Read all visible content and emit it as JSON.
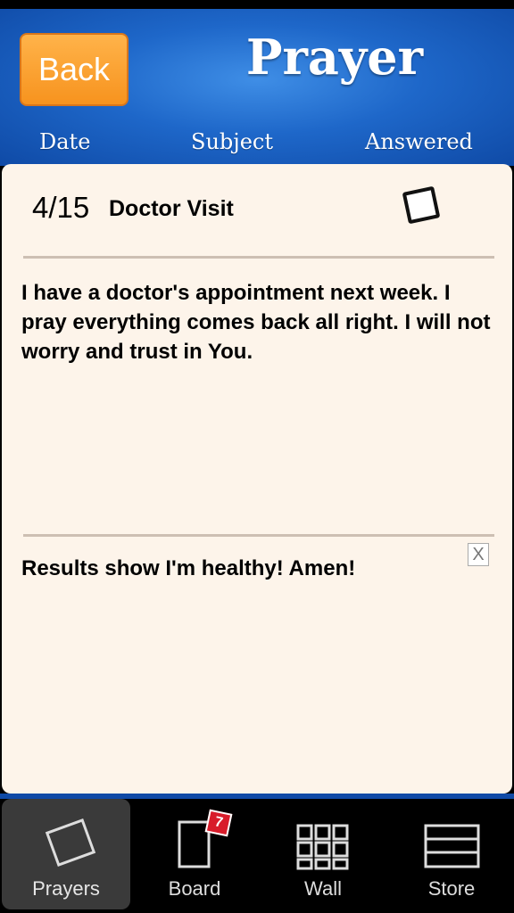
{
  "header": {
    "back_label": "Back",
    "title": "Prayer",
    "columns": {
      "date": "Date",
      "subject": "Subject",
      "answered": "Answered"
    }
  },
  "entry": {
    "date": "4/15",
    "subject": "Doctor Visit",
    "answered": false,
    "prayer": "I have a doctor's appointment next week. I pray everything comes back all right. I will not worry and trust in You.",
    "answer": "Results show I'm healthy! Amen!",
    "clear_label": "X"
  },
  "tabbar": {
    "tabs": [
      {
        "label": "Prayers",
        "icon": "prayer-card-icon",
        "active": true
      },
      {
        "label": "Board",
        "icon": "board-icon",
        "active": false,
        "badge": "7"
      },
      {
        "label": "Wall",
        "icon": "grid-icon",
        "active": false
      },
      {
        "label": "Store",
        "icon": "store-icon",
        "active": false
      }
    ]
  },
  "colors": {
    "header_blue": "#1e67c9",
    "back_orange": "#f7931e",
    "card_bg": "#fdf4ea",
    "badge_red": "#d81c2a"
  }
}
